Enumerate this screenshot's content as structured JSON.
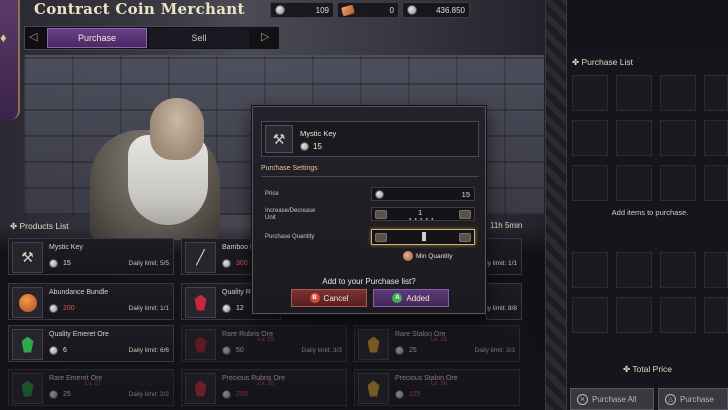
{
  "window": {
    "title": "Contract Coin Merchant"
  },
  "currencies": [
    {
      "icon": "silver-coin-icon",
      "value": "109"
    },
    {
      "icon": "ticket-icon",
      "value": "0"
    },
    {
      "icon": "silver-coin-icon",
      "value": "436.850"
    }
  ],
  "tabs": [
    {
      "label": "Purchase",
      "selected": true
    },
    {
      "label": "Sell",
      "selected": false
    }
  ],
  "products": {
    "header": "Products List",
    "timer": "11h 5min",
    "items": [
      {
        "name": "Mystic Key",
        "icon": "key-icon",
        "price": "15",
        "limit": "Daily limit: 5/5",
        "level": ""
      },
      {
        "name": "Bamboo F",
        "icon": "bamboo-icon",
        "price": "300",
        "limit": "Daily limit: 1/1",
        "level": ""
      },
      {
        "name": "Abundance Bundle",
        "icon": "bundle-icon",
        "price": "200",
        "limit": "Daily limit: 1/1",
        "level": ""
      },
      {
        "name": "Quality R",
        "icon": "ruby-ore-icon",
        "price": "12",
        "limit": "Daily limit: 8/8",
        "level": ""
      },
      {
        "name": "Quality Emeret Ore",
        "icon": "emerald-ore-icon",
        "price": "6",
        "limit": "Daily limit: 6/6",
        "level": ""
      },
      {
        "name": "Rare Rubris Ore",
        "icon": "ruby-ore-icon",
        "price": "50",
        "limit": "Daily limit: 3/3",
        "level": "Lv. 25"
      },
      {
        "name": "Rare Stalon Ore",
        "icon": "stalon-ore-icon",
        "price": "25",
        "limit": "Daily limit: 3/3",
        "level": "Lv. 26"
      },
      {
        "name": "Rare Emeret Ore",
        "icon": "emerald-ore-icon",
        "price": "25",
        "limit": "Daily limit: 2/2",
        "level": "Lv. 27"
      },
      {
        "name": "Precious Rubris Ore",
        "icon": "ruby-ore-icon",
        "price": "250",
        "limit": "",
        "level": "Lv. 35"
      },
      {
        "name": "Precious Stalon Ore",
        "icon": "stalon-ore-icon",
        "price": "125",
        "limit": "",
        "level": "Lv. 36"
      }
    ]
  },
  "dialog": {
    "item_name": "Mystic Key",
    "item_qty": "15",
    "settings_title": "Purchase Settings",
    "price_label": "Price",
    "price_value": "15",
    "increment_label_1": "Increase/Decrease",
    "increment_label_2": "Unit",
    "increment_value": "1",
    "increment_dots": "● ● ● ● ●",
    "quantity_label": "Purchase Quantity",
    "min_quantity": "Min Quantity",
    "confirm_text": "Add to your Purchase list?",
    "cancel_label": "Cancel",
    "added_label": "Added",
    "cancel_glyph": "B",
    "added_glyph": "A"
  },
  "purchase_list": {
    "title": "Purchase List",
    "empty_text": "Add items to purchase.",
    "total_label": "Total Price",
    "purchase_all_label": "Purchase All",
    "purchase_label": "Purchase"
  },
  "colors": {
    "accent": "#6b3f8a",
    "cancel": "#7a3232",
    "warning": "#e04848"
  }
}
